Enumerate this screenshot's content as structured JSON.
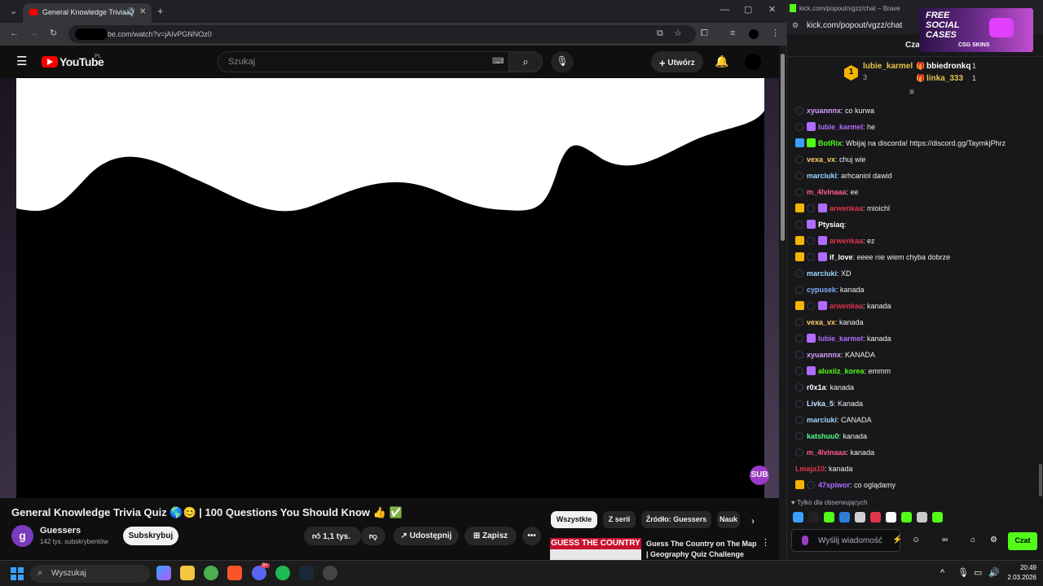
{
  "left_browser": {
    "tab_title": "General Knowledge Trivia Q",
    "url": "be.com/watch?v=jAIvPGNNOz0",
    "youtube": {
      "logo_text": "YouTube",
      "region": "PL",
      "search_placeholder": "Szukaj",
      "create_label": "Utwórz",
      "video_title": "General Knowledge Trivia Quiz 🌎😊 | 100 Questions You Should Know 👍 ✅",
      "channel_name": "Guessers",
      "channel_initial": "g",
      "channel_subs": "142 tys. subskrybentów",
      "subscribe_label": "Subskrybuj",
      "likes": "1,1 tys.",
      "share_label": "Udostępnij",
      "save_label": "Zapisz",
      "sub_badge": "SUB",
      "chips": [
        "Wszystkie",
        "Z serii",
        "Źródło: Guessers",
        "Nauk"
      ],
      "reco": {
        "thumb_text": "GUESS THE COUNTRY",
        "title": "Guess The Country on The Map | Geography Quiz Challenge"
      }
    }
  },
  "right_browser": {
    "window_title": "kick.com/popout/vgzz/chat – Brave",
    "url": "kick.com/popout/vgzz/chat",
    "header_label": "Cza",
    "ad": {
      "line1": "FREE",
      "line2": "SOCIAL",
      "line3": "CASES",
      "sponsor": "CSG SKINS"
    },
    "leaderboard": {
      "rank": "1",
      "top_user": "lubie_karmel",
      "top_count": "3",
      "others": [
        {
          "name": "bbiedronkq",
          "count": "1"
        },
        {
          "name": "linka_333",
          "count": "1"
        }
      ]
    },
    "messages": [
      {
        "user": "xyuannnx",
        "color": "#d6a0ff",
        "text": ": co kurwa",
        "badges": [
          "ring"
        ]
      },
      {
        "user": "lubie_karmel",
        "color": "#b06bff",
        "text": ": he",
        "badges": [
          "ring",
          "sub"
        ]
      },
      {
        "user": "BotRix",
        "color": "#53fc18",
        "text": ": Wbijaj na discorda! https://discord.gg/TaymkjPhrz",
        "badges": [
          "bot",
          "verified"
        ]
      },
      {
        "user": "vexa_vx",
        "color": "#ffcc66",
        "text": ": chuj wie",
        "badges": [
          "ring"
        ]
      },
      {
        "user": "marciuki",
        "color": "#9ad7ff",
        "text": ": arhcaniol dawid",
        "badges": [
          "ring"
        ]
      },
      {
        "user": "m_4lvinaaa",
        "color": "#ff5c8a",
        "text": ": ee",
        "badges": [
          "ring"
        ]
      },
      {
        "user": "arwenkaa",
        "color": "#e0344a",
        "text": ": mioichl",
        "badges": [
          "crown",
          "ring",
          "sub"
        ]
      },
      {
        "user": "Ptysiaq",
        "color": "#ffffff",
        "text": ":",
        "badges": [
          "ring",
          "sub"
        ]
      },
      {
        "user": "arwenkaa",
        "color": "#e0344a",
        "text": ": ez",
        "badges": [
          "crown",
          "ring",
          "sub"
        ]
      },
      {
        "user": "if_love",
        "color": "#ffffff",
        "text": ": eeee nie wiem chyba dobrze",
        "badges": [
          "crown",
          "ring",
          "sub"
        ]
      },
      {
        "user": "marciuki",
        "color": "#9ad7ff",
        "text": ": XD",
        "badges": [
          "ring"
        ]
      },
      {
        "user": "cypusek",
        "color": "#7fb3ff",
        "text": ": kanada",
        "badges": [
          "ring"
        ]
      },
      {
        "user": "arwenkaa",
        "color": "#e0344a",
        "text": ": kanada",
        "badges": [
          "crown",
          "ring",
          "sub"
        ]
      },
      {
        "user": "vexa_vx",
        "color": "#ffcc66",
        "text": ": kanada",
        "badges": [
          "ring"
        ]
      },
      {
        "user": "lubie_karmel",
        "color": "#b06bff",
        "text": ": kanada",
        "badges": [
          "ring",
          "sub"
        ]
      },
      {
        "user": "xyuannnx",
        "color": "#d6a0ff",
        "text": ": KANADA",
        "badges": [
          "ring"
        ]
      },
      {
        "user": "aluxiiz_korea",
        "color": "#53fc18",
        "text": ": emmm",
        "badges": [
          "ring",
          "sub"
        ]
      },
      {
        "user": "r0x1a",
        "color": "#ffffff",
        "text": ": kanada",
        "badges": [
          "ring"
        ]
      },
      {
        "user": "Livka_5",
        "color": "#c0e0ff",
        "text": ": Kanada",
        "badges": [
          "ring"
        ]
      },
      {
        "user": "marciuki",
        "color": "#9ad7ff",
        "text": ": CANADA",
        "badges": [
          "ring"
        ]
      },
      {
        "user": "katshuu0",
        "color": "#53fc88",
        "text": ": kanada",
        "badges": [
          "ring"
        ]
      },
      {
        "user": "m_4lvinaaa",
        "color": "#ff5c8a",
        "text": ": kanada",
        "badges": [
          "ring"
        ]
      },
      {
        "user": "Lmaja10",
        "color": "#e0344a",
        "text": ": kanada",
        "badges": []
      },
      {
        "user": "47spiwor",
        "color": "#b06bff",
        "text": ": co oglądamy",
        "badges": [
          "crown",
          "ring"
        ]
      }
    ],
    "followers_only": "Tylko dla obserwujących",
    "chat_placeholder": "Wyślij wiadomość",
    "send_label": "Czat"
  },
  "taskbar": {
    "search_label": "Wyszukaj",
    "time": "20:49",
    "date": "2.03.2026",
    "notification_count": "9+"
  },
  "colors": {
    "yt_red": "#ff0000",
    "kick_green": "#53fc18",
    "bg_dark": "#0f0f0f",
    "chat_bg": "#18181b"
  }
}
